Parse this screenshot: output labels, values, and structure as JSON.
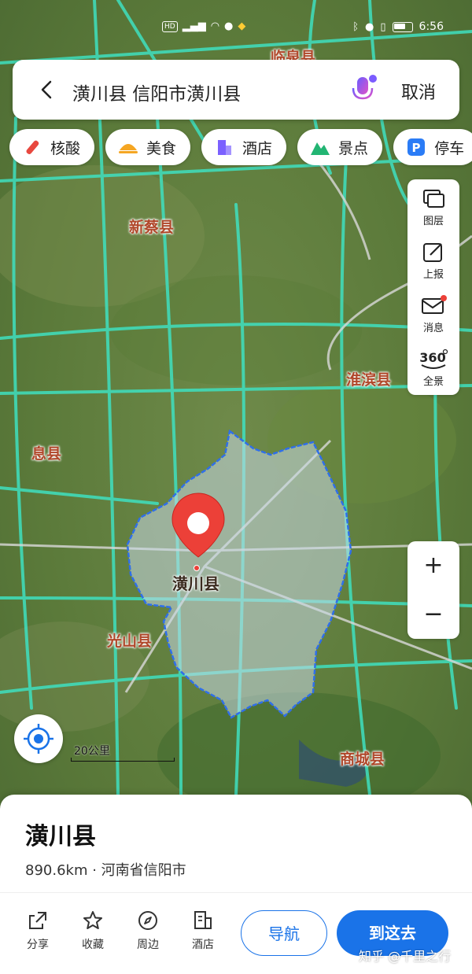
{
  "status_bar": {
    "indicators": [
      "HD",
      "5G",
      "wifi"
    ],
    "time": "6:56"
  },
  "search": {
    "query": "潢川县 信阳市潢川县",
    "cancel_label": "取消"
  },
  "chips": [
    {
      "label": "核酸",
      "icon": "test-tube-icon",
      "color": "#e8483f"
    },
    {
      "label": "美食",
      "icon": "food-icon",
      "color": "#f5a623"
    },
    {
      "label": "酒店",
      "icon": "hotel-icon",
      "color": "#7b61ff"
    },
    {
      "label": "景点",
      "icon": "mountain-icon",
      "color": "#22b573"
    },
    {
      "label": "停车",
      "icon": "parking-icon",
      "color": "#2b7cf6"
    }
  ],
  "tools": [
    {
      "label": "图层",
      "icon": "layers-icon"
    },
    {
      "label": "上报",
      "icon": "report-edit-icon"
    },
    {
      "label": "消息",
      "icon": "message-icon"
    },
    {
      "label": "全景",
      "icon": "panorama-360-icon"
    }
  ],
  "zoom": {
    "in_label": "+",
    "out_label": "−"
  },
  "map": {
    "labels": [
      {
        "id": "linquan",
        "text": "临泉县"
      },
      {
        "id": "xincai",
        "text": "新蔡县"
      },
      {
        "id": "huaibin",
        "text": "淮滨县"
      },
      {
        "id": "xixian",
        "text": "息县"
      },
      {
        "id": "guangshan",
        "text": "光山县"
      },
      {
        "id": "shangcheng",
        "text": "商城县"
      }
    ],
    "center_label": "潢川县",
    "scale_label": "20公里"
  },
  "place": {
    "title": "潢川县",
    "subtitle": "890.6km · 河南省信阳市"
  },
  "actions": [
    {
      "label": "分享",
      "icon": "share-icon"
    },
    {
      "label": "收藏",
      "icon": "star-icon"
    },
    {
      "label": "周边",
      "icon": "compass-icon"
    },
    {
      "label": "酒店",
      "icon": "hotel-icon"
    }
  ],
  "nav_label": "导航",
  "go_label": "到这去",
  "watermark": "知乎 @千里之行"
}
